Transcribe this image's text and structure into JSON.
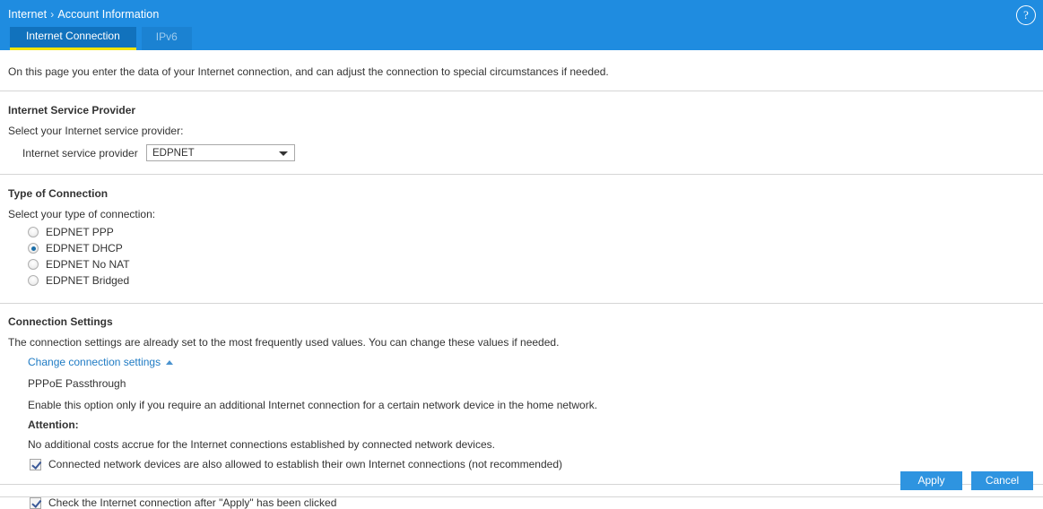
{
  "header": {
    "breadcrumb": {
      "root": "Internet",
      "separator": "›",
      "current": "Account Information"
    },
    "help_icon": "?",
    "background_color": "#1f8ce0",
    "tabs": [
      {
        "label": "Internet Connection",
        "active": true
      },
      {
        "label": "IPv6",
        "active": false
      }
    ],
    "active_tab_underline_color": "#f2e400"
  },
  "intro": {
    "text": "On this page you enter the data of your Internet connection, and can adjust the connection to special circumstances if needed."
  },
  "isp_section": {
    "title": "Internet Service Provider",
    "subtitle": "Select your Internet service provider:",
    "field_label": "Internet service provider",
    "selected_value": "EDPNET",
    "options": [
      "EDPNET"
    ]
  },
  "connection_type_section": {
    "title": "Type of Connection",
    "subtitle": "Select your type of connection:",
    "options": [
      {
        "label": "EDPNET PPP",
        "selected": false
      },
      {
        "label": "EDPNET DHCP",
        "selected": true
      },
      {
        "label": "EDPNET No NAT",
        "selected": false
      },
      {
        "label": "EDPNET Bridged",
        "selected": false
      }
    ]
  },
  "connection_settings_section": {
    "title": "Connection Settings",
    "description": "The connection settings are already set to the most frequently used values. You can change these values if needed.",
    "link_label": "Change connection settings",
    "subheading": "PPPoE Passthrough",
    "enable_text": "Enable this option only if you require an additional Internet connection for a certain network device in the home network.",
    "attention_label": "Attention:",
    "attention_text": "No additional costs accrue for the Internet connections established by connected network devices.",
    "checkbox": {
      "label": "Connected network devices are also allowed to establish their own Internet connections (not recommended)",
      "checked": true
    }
  },
  "check_connection": {
    "label": "Check the Internet connection after \"Apply\" has been clicked",
    "checked": true
  },
  "footer": {
    "apply_label": "Apply",
    "cancel_label": "Cancel",
    "button_color": "#2e94e0"
  }
}
